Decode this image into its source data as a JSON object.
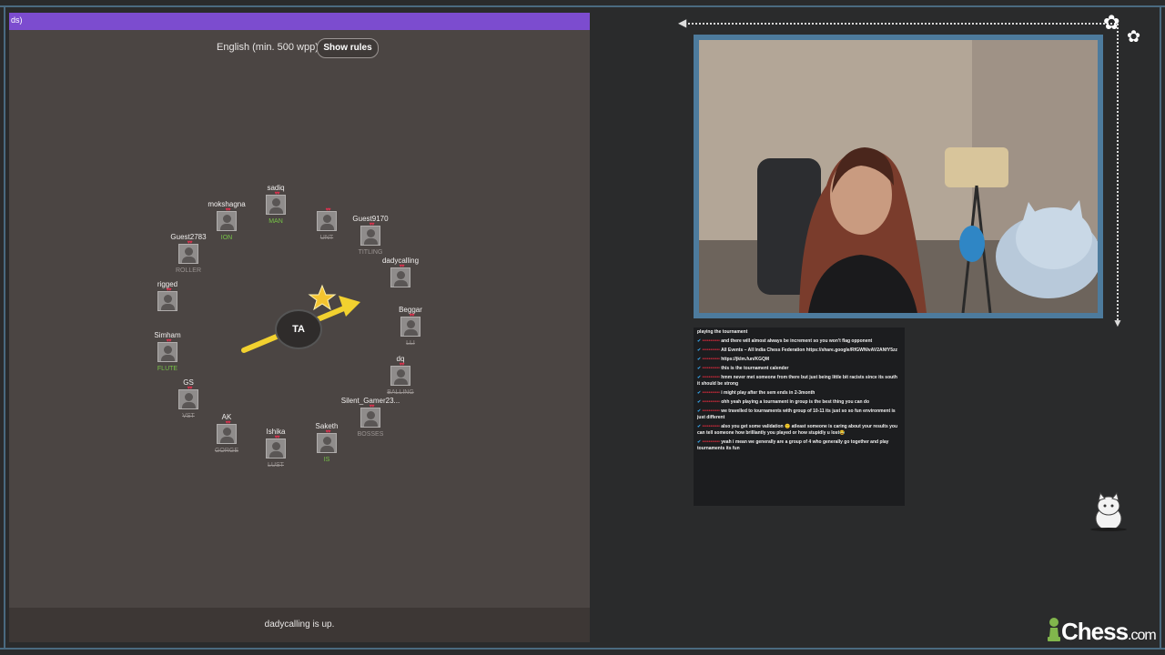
{
  "game": {
    "topbar_text": "ds)",
    "language_label": "English (min. 500 wpp)",
    "rules_button": "Show rules",
    "status_text": "dadycalling is up.",
    "turn_initials": "TA"
  },
  "players": [
    {
      "name": "sadiq",
      "word": "MAN",
      "word_style": "g"
    },
    {
      "name": "",
      "word": "UNT",
      "word_style": "s"
    },
    {
      "name": "Guest9170",
      "word": "TITLING",
      "word_style": "d"
    },
    {
      "name": "dadycalling",
      "word": "",
      "word_style": "d"
    },
    {
      "name": "Beggar",
      "word": "LLI",
      "word_style": "s"
    },
    {
      "name": "dq",
      "word": "BALLING",
      "word_style": "s"
    },
    {
      "name": "Silent_Gamer23...",
      "word": "BOSSES",
      "word_style": "d"
    },
    {
      "name": "Saketh",
      "word": "IS",
      "word_style": "g"
    },
    {
      "name": "Ishika",
      "word": "LUST",
      "word_style": "s"
    },
    {
      "name": "AK",
      "word": "GORGE",
      "word_style": "s"
    },
    {
      "name": "GS",
      "word": "VST",
      "word_style": "s"
    },
    {
      "name": "Simham",
      "word": "FLUTE",
      "word_style": "g"
    },
    {
      "name": "rigged",
      "word": "",
      "word_style": "d"
    },
    {
      "name": "Guest2783",
      "word": "ROLLER",
      "word_style": "d"
    },
    {
      "name": "mokshagna",
      "word": "ION",
      "word_style": "g"
    }
  ],
  "chat": {
    "messages": [
      {
        "user": "",
        "text": "playing the tournament"
      },
      {
        "user": "•••••••••••",
        "text": "and there will almost always be increment so you won't flag opponent"
      },
      {
        "user": "•••••••••••",
        "text": "All Events – All India Chess Federation https://share.google/RfGWNlvAV2ANfY5zz"
      },
      {
        "user": "•••••••••••",
        "text": "https://jklm.fun/KGQM"
      },
      {
        "user": "•••••••••••",
        "text": "this is the tournament calender"
      },
      {
        "user": "•••••••••••",
        "text": "hmm never met someone from there but just being little bit racists since its south it should be strong"
      },
      {
        "user": "•••••••••••",
        "text": "i might play after the sem ends in 2-3month"
      },
      {
        "user": "•••••••••••",
        "text": "ohh yeah playing a tournament in group is the best thing you can do"
      },
      {
        "user": "•••••••••••",
        "text": "we travelled to tournaments with group of 10-11 its just so so fun environment is just different"
      },
      {
        "user": "•••••••••••",
        "text": "also you get some validation 🙂 atleast someone is caring about your results you can tell someone how brilliantly you played or how stupidly u lost😂"
      },
      {
        "user": "•••••••••••",
        "text": "yeah i mean we generally are a group of 4 who generally go together and play tournaments its fun"
      }
    ]
  },
  "brand": {
    "logo_text": "Chess",
    "logo_suffix": ".com",
    "accent": "#7c4ccf",
    "chess_green": "#81b64c"
  }
}
